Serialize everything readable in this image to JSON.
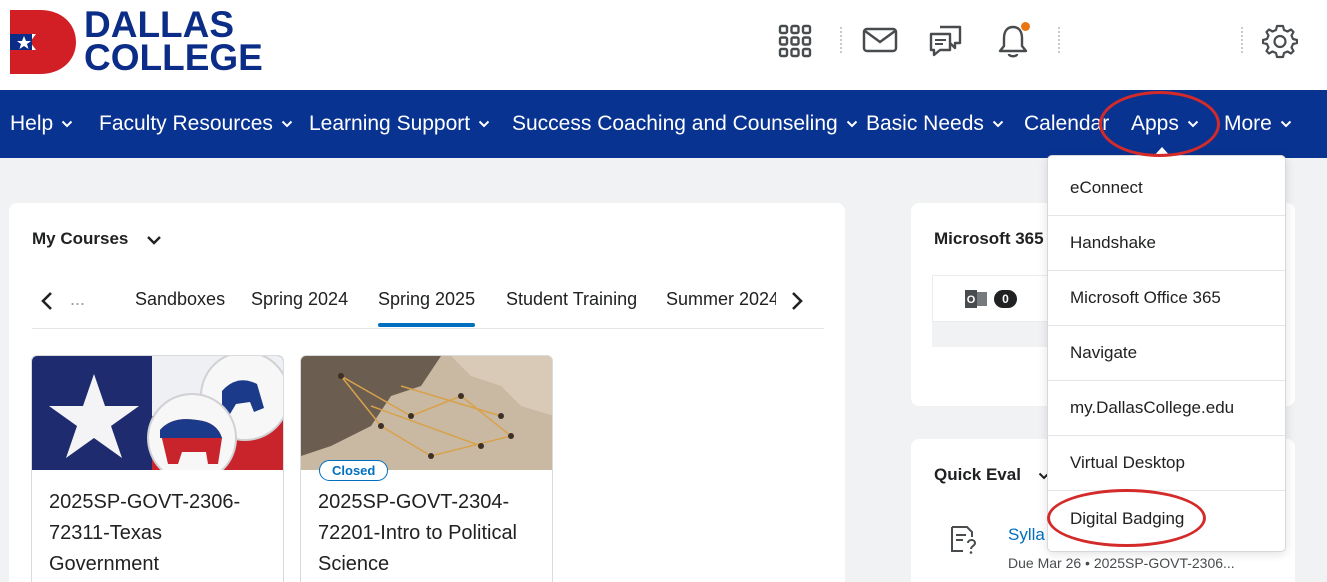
{
  "brand": {
    "logo_line1": "DALLAS",
    "logo_line2": "COLLEGE",
    "primary_color": "#093391",
    "accent_color": "#006fbf",
    "logo_red": "#d21f26"
  },
  "header_icons": [
    "apps-grid-icon",
    "mail-icon",
    "chat-icon",
    "notifications-bell-icon",
    "settings-gear-icon"
  ],
  "nav": {
    "items": [
      {
        "label": "Help",
        "has_menu": true
      },
      {
        "label": "Faculty Resources",
        "has_menu": true
      },
      {
        "label": "Learning Support",
        "has_menu": true
      },
      {
        "label": "Success Coaching and Counseling",
        "has_menu": true
      },
      {
        "label": "Basic Needs",
        "has_menu": true
      },
      {
        "label": "Calendar",
        "has_menu": false
      },
      {
        "label": "Apps",
        "has_menu": true,
        "open": true
      },
      {
        "label": "More",
        "has_menu": true
      }
    ]
  },
  "my_courses": {
    "title": "My Courses",
    "tabs": [
      "...",
      "Sandboxes",
      "Spring 2024",
      "Spring 2025",
      "Student Training",
      "Summer 2024"
    ],
    "active_tab": "Spring 2025",
    "courses": [
      {
        "name": "2025SP-GOVT-2306-72311-Texas Government",
        "badge": ""
      },
      {
        "name": "2025SP-GOVT-2304-72201-Intro to Political Science",
        "badge": "Closed"
      }
    ]
  },
  "microsoft_widget": {
    "title": "Microsoft 365",
    "mail_count": "0"
  },
  "quick_eval": {
    "title": "Quick Eval",
    "item_link": "Sylla",
    "item_due": "Due Mar 26",
    "item_course": "2025SP-GOVT-2306..."
  },
  "apps_menu": {
    "items": [
      "eConnect",
      "Handshake",
      "Microsoft Office 365",
      "Navigate",
      "my.DallasCollege.edu",
      "Virtual Desktop",
      "Digital Badging"
    ]
  }
}
